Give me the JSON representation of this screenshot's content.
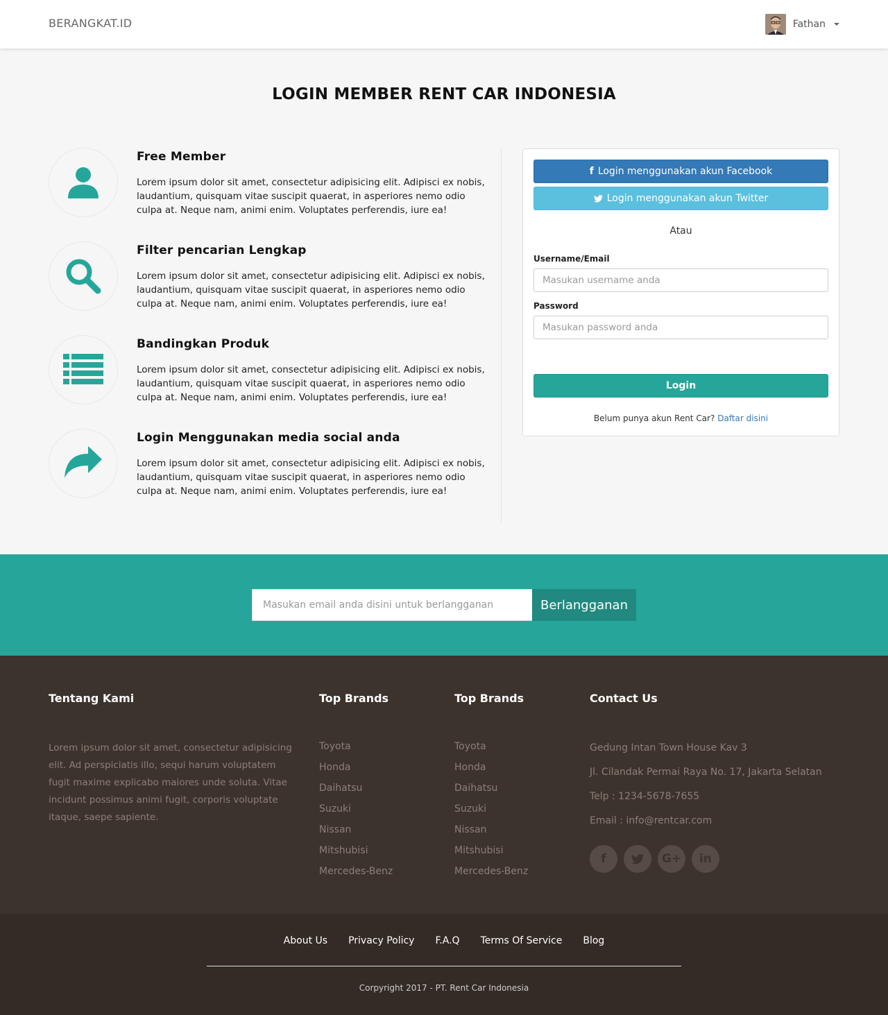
{
  "navbar": {
    "brand": "BERANGKAT.ID",
    "user_name": "Fathan"
  },
  "main": {
    "title": "LOGIN MEMBER RENT CAR INDONESIA",
    "features": [
      {
        "icon": "user-icon",
        "title": "Free Member",
        "text": "Lorem ipsum dolor sit amet, consectetur adipisicing elit. Adipisci ex nobis, laudantium, quisquam vitae suscipit quaerat, in asperiores nemo odio culpa at. Neque nam, animi enim. Voluptates perferendis, iure ea!"
      },
      {
        "icon": "search-icon",
        "title": "Filter pencarian Lengkap",
        "text": "Lorem ipsum dolor sit amet, consectetur adipisicing elit. Adipisci ex nobis, laudantium, quisquam vitae suscipit quaerat, in asperiores nemo odio culpa at. Neque nam, animi enim. Voluptates perferendis, iure ea!"
      },
      {
        "icon": "list-icon",
        "title": "Bandingkan Produk",
        "text": "Lorem ipsum dolor sit amet, consectetur adipisicing elit. Adipisci ex nobis, laudantium, quisquam vitae suscipit quaerat, in asperiores nemo odio culpa at. Neque nam, animi enim. Voluptates perferendis, iure ea!"
      },
      {
        "icon": "share-icon",
        "title": "Login Menggunakan media social anda",
        "text": "Lorem ipsum dolor sit amet, consectetur adipisicing elit. Adipisci ex nobis, laudantium, quisquam vitae suscipit quaerat, in asperiores nemo odio culpa at. Neque nam, animi enim. Voluptates perferendis, iure ea!"
      }
    ]
  },
  "login": {
    "facebook_label": "Login menggunakan akun Facebook",
    "twitter_label": "Login menggunakan akun Twitter",
    "or_label": "Atau",
    "username_label": "Username/Email",
    "username_placeholder": "Masukan username anda",
    "password_label": "Password",
    "password_placeholder": "Masukan password anda",
    "login_button": "Login",
    "signup_text": "Belum punya akun Rent Car?",
    "signup_link": "Daftar disini"
  },
  "subscribe": {
    "placeholder": "Masukan email anda disini untuk berlangganan",
    "button": "Berlangganan"
  },
  "footer": {
    "about_title": "Tentang Kami",
    "about_text": "Lorem ipsum dolor sit amet, consectetur adipisicing elit. Ad perspiciatis illo, sequi harum voluptatem fugit maxime explicabo maiores unde soluta. Vitae incidunt possimus animi fugit, corporis voluptate itaque, saepe sapiente.",
    "brands_1_title": "Top Brands",
    "brands_1": [
      "Toyota",
      "Honda",
      "Daihatsu",
      "Suzuki",
      "Nissan",
      "Mitshubisi",
      "Mercedes-Benz"
    ],
    "brands_2_title": "Top Brands",
    "brands_2": [
      "Toyota",
      "Honda",
      "Daihatsu",
      "Suzuki",
      "Nissan",
      "Mitshubisi",
      "Mercedes-Benz"
    ],
    "contact_title": "Contact Us",
    "contact": [
      "Gedung Intan Town House Kav 3",
      "Jl. Cilandak Permai Raya No. 17, Jakarta Selatan",
      "Telp : 1234-5678-7655",
      "Email : info@rentcar.com"
    ],
    "socials": [
      {
        "icon": "facebook-icon",
        "glyph": "f"
      },
      {
        "icon": "twitter-icon",
        "glyph": "t"
      },
      {
        "icon": "google-plus-icon",
        "glyph": "G+"
      },
      {
        "icon": "linkedin-icon",
        "glyph": "in"
      }
    ]
  },
  "bottom": {
    "links": [
      "About Us",
      "Privacy Policy",
      "F.A.Q",
      "Terms Of Service",
      "Blog"
    ],
    "copyright": "Corpyright 2017 - PT. Rent Car Indonesia"
  },
  "colors": {
    "accent": "#26a69a",
    "facebook": "#337ab7",
    "twitter": "#5bc0de",
    "footer": "#3d332d",
    "bottom_bar": "#342b26"
  }
}
